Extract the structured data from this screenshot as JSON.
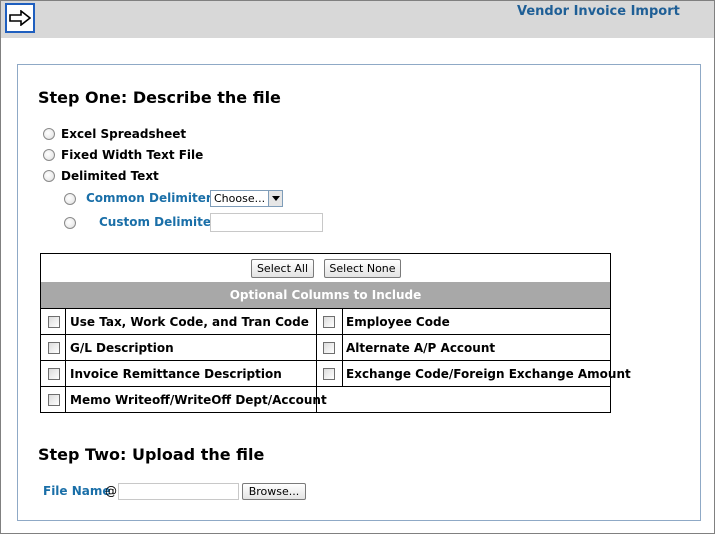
{
  "header": {
    "title": "Vendor Invoice Import"
  },
  "step_one": {
    "title": "Step One: Describe the file",
    "file_types": [
      {
        "label": "Excel Spreadsheet"
      },
      {
        "label": "Fixed Width Text File"
      },
      {
        "label": "Delimited Text"
      }
    ],
    "common_delimiters_label": "Common Delimiters",
    "common_delimiters_value": "Choose...",
    "custom_delimiter_label": "Custom Delimiter",
    "custom_delimiter_value": ""
  },
  "columns": {
    "select_all_label": "Select All",
    "select_none_label": "Select None",
    "header": "Optional Columns to Include",
    "left": [
      "Use Tax, Work Code, and Tran Code",
      "G/L Description",
      "Invoice Remittance Description",
      "Memo Writeoff/WriteOff Dept/Account"
    ],
    "right": [
      "Employee Code",
      "Alternate A/P Account",
      "Exchange Code/Foreign Exchange Amount"
    ]
  },
  "step_two": {
    "title": "Step Two: Upload the file",
    "file_name_label": "File Name",
    "at_sign": "@",
    "file_value": "",
    "browse_label": "Browse..."
  }
}
